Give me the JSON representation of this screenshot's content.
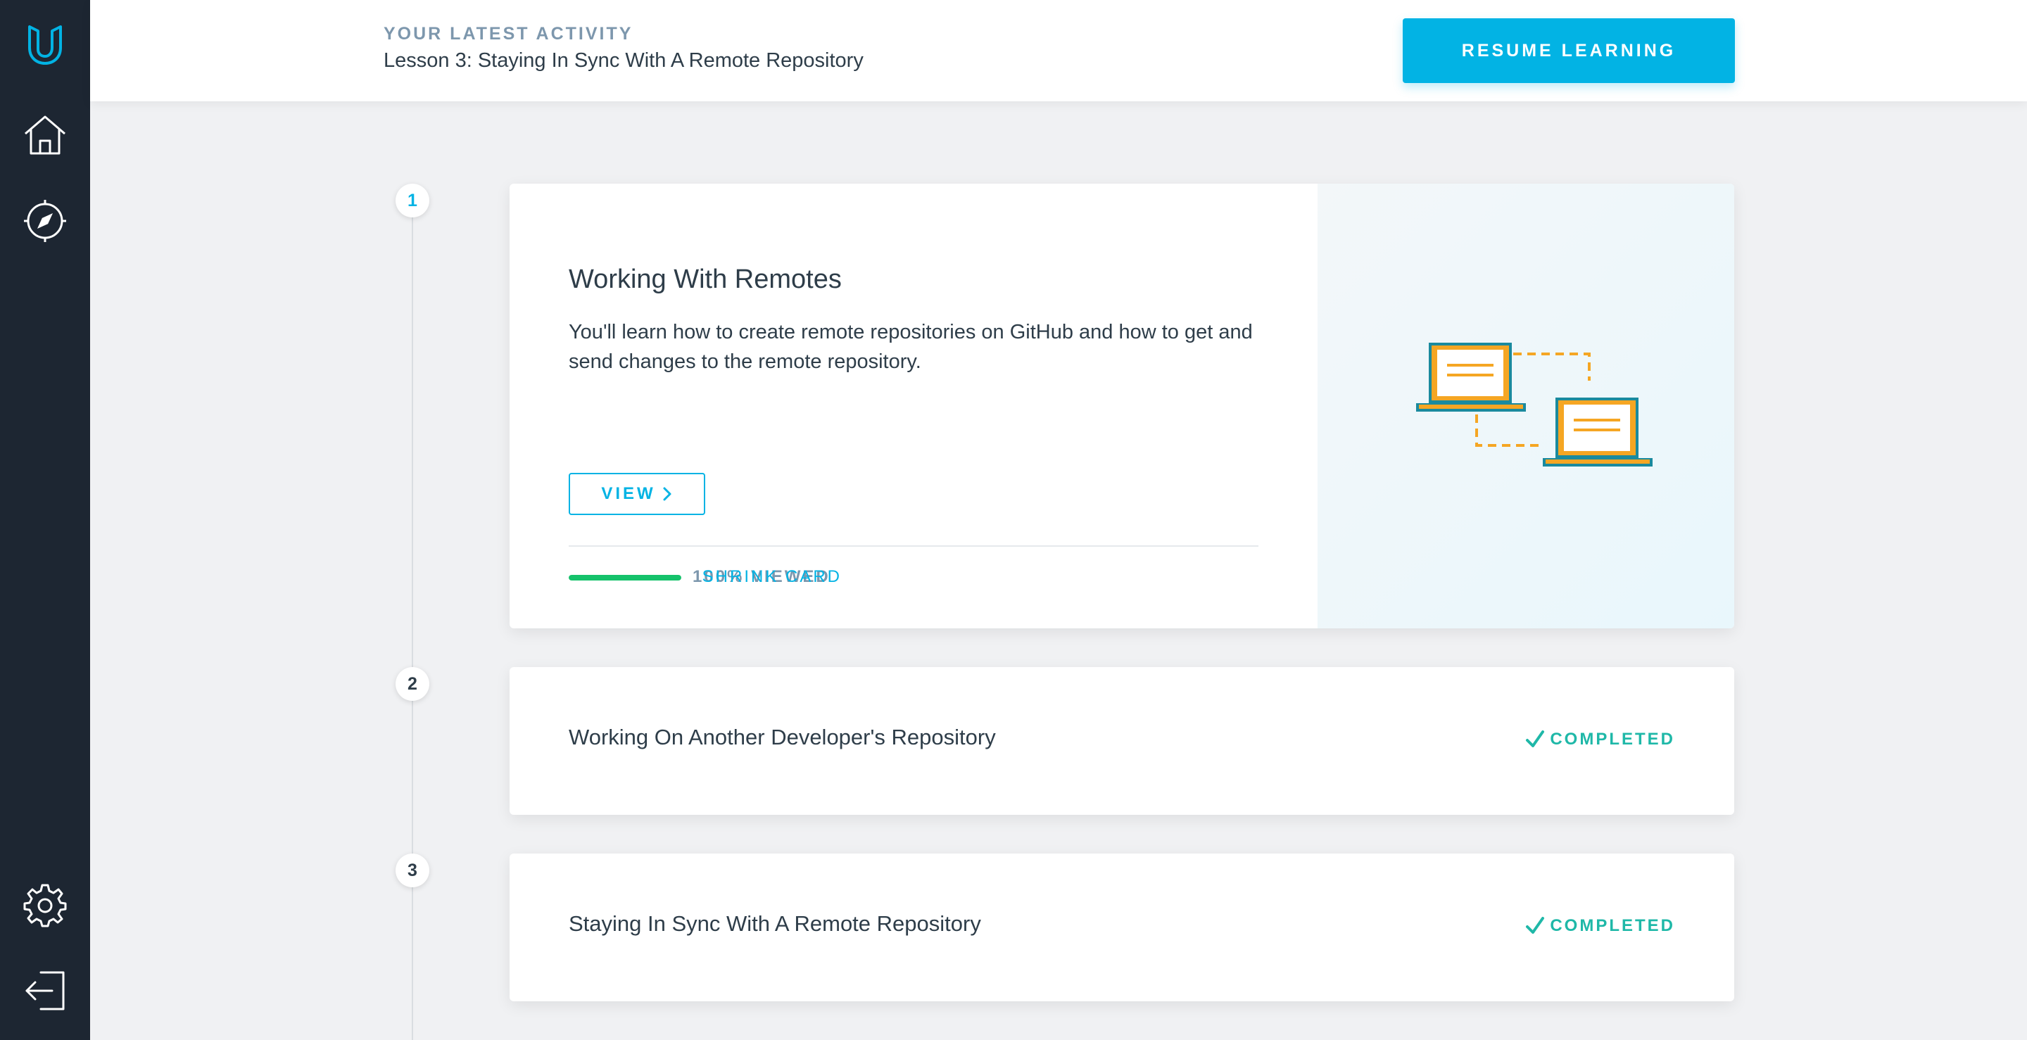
{
  "sidebar": {
    "items": [
      {
        "name": "udacity-logo-icon"
      },
      {
        "name": "home-icon"
      },
      {
        "name": "compass-icon"
      },
      {
        "name": "settings-icon"
      },
      {
        "name": "logout-icon"
      }
    ]
  },
  "header": {
    "kicker": "YOUR LATEST ACTIVITY",
    "activity_title": "Lesson 3: Staying In Sync With A Remote Repository",
    "resume_label": "RESUME LEARNING"
  },
  "colors": {
    "sidebar_bg": "#1d2632",
    "accent": "#02b3e4",
    "success": "#15c26b",
    "illustration_orange": "#f5a623",
    "illustration_teal": "#1a8a9e"
  },
  "steps": [
    {
      "number": "1"
    },
    {
      "number": "2"
    },
    {
      "number": "3"
    }
  ],
  "lessons": [
    {
      "title": "Working With Remotes",
      "description": "You'll learn how to create remote repositories on GitHub and how to get and send changes to the remote repository.",
      "view_label": "VIEW",
      "progress_percent": 100,
      "progress_label": "100% VIEWED",
      "shrink_label": "SHRINK CARD",
      "illustration": "two-laptops-connected-icon"
    },
    {
      "title": "Working On Another Developer's Repository",
      "status": "COMPLETED"
    },
    {
      "title": "Staying In Sync With A Remote Repository",
      "status": "COMPLETED"
    }
  ]
}
